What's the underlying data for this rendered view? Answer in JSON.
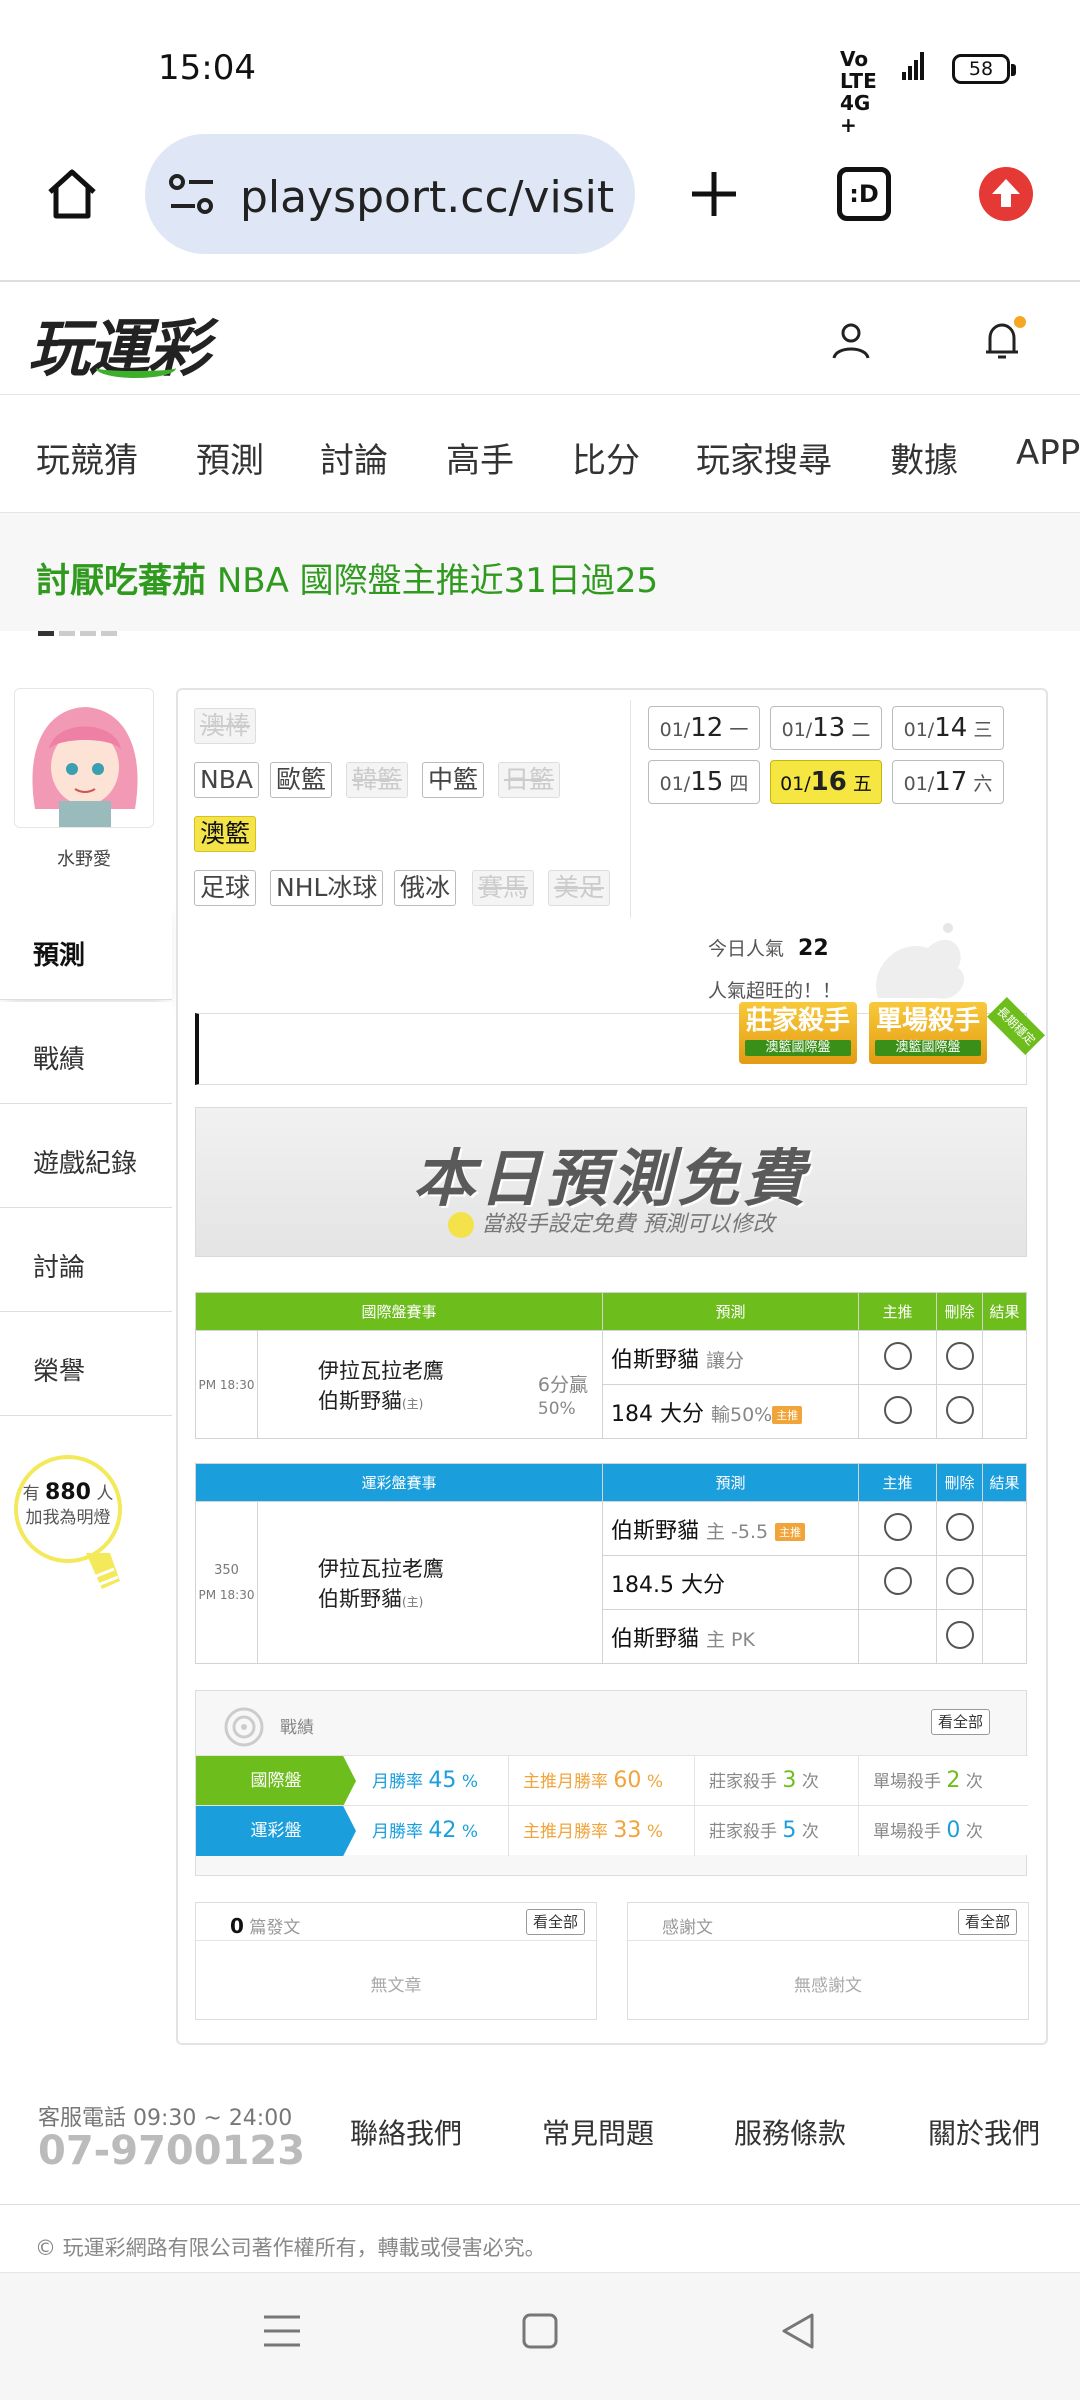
{
  "status_bar": {
    "time": "15:04",
    "network": "Vo LTE 4G+",
    "battery": "58"
  },
  "browser": {
    "url": "playsport.cc/visit",
    "tab_icon": ":D"
  },
  "site": {
    "logo": "玩運彩"
  },
  "main_nav": [
    "玩競猜",
    "預測",
    "討論",
    "高手",
    "比分",
    "玩家搜尋",
    "數據",
    "APP"
  ],
  "marquee": {
    "user": "討厭吃蕃茄",
    "text": "NBA 國際盤主推近31日過25"
  },
  "profile": {
    "name": "水野愛",
    "side_tabs": [
      "預測",
      "戰績",
      "遊戲紀錄",
      "討論",
      "榮譽"
    ],
    "fans_prefix": "有",
    "fans_count": "880",
    "fans_unit": "人",
    "fans_action": "加我為明燈"
  },
  "sports": {
    "row1": [
      "澳棒"
    ],
    "row2": [
      "NBA",
      "歐籃",
      "韓籃",
      "中籃",
      "日籃"
    ],
    "row3": [
      "澳籃"
    ],
    "row4": [
      "足球",
      "NHL冰球",
      "俄冰",
      "賽馬",
      "美足"
    ]
  },
  "dates": [
    {
      "md": "01/",
      "d": "12",
      "w": "一"
    },
    {
      "md": "01/",
      "d": "13",
      "w": "二"
    },
    {
      "md": "01/",
      "d": "14",
      "w": "三"
    },
    {
      "md": "01/",
      "d": "15",
      "w": "四"
    },
    {
      "md": "01/",
      "d": "16",
      "w": "五"
    },
    {
      "md": "01/",
      "d": "17",
      "w": "六"
    }
  ],
  "popularity": {
    "label": "今日人氣",
    "value": "22",
    "note": "人氣超旺的！！"
  },
  "badges": {
    "b1": "莊家殺手",
    "b1_sub": "澳籃國際盤",
    "b2": "單場殺手",
    "b2_sub": "澳籃國際盤",
    "ribbon": "長期穩定"
  },
  "free_banner": {
    "title": "本日預測免費",
    "subtitle": "當殺手設定免費 預測可以修改"
  },
  "intl_table": {
    "headers": [
      "國際盤賽事",
      "預測",
      "主推",
      "刪除",
      "結果"
    ],
    "time": "PM 18:30",
    "team1": "伊拉瓦拉老鷹",
    "team2": "伯斯野貓",
    "home_mark": "(主)",
    "spread": "6分贏",
    "spread_pct": "50%",
    "pred1": "伯斯野貓",
    "pred1_note": "讓分",
    "pred2": "184 大分",
    "pred2_note": "輸50%",
    "pred2_tag": "主推"
  },
  "lottery_table": {
    "headers": [
      "運彩盤賽事",
      "預測",
      "主推",
      "刪除",
      "結果"
    ],
    "game_no": "350",
    "time": "PM 18:30",
    "team1": "伊拉瓦拉老鷹",
    "team2": "伯斯野貓",
    "home_mark": "(主)",
    "pred1": "伯斯野貓",
    "pred1_note": "主 -5.5",
    "pred1_tag": "主推",
    "pred2": "184.5 大分",
    "pred3": "伯斯野貓",
    "pred3_note": "主 PK"
  },
  "record": {
    "title": "戰績",
    "see_all": "看全部",
    "rows": [
      {
        "label": "國際盤",
        "win_label": "月勝率",
        "win": "45",
        "main_label": "主推月勝率",
        "main": "60",
        "pct": "%",
        "k1_label": "莊家殺手",
        "k1": "3",
        "k2_label": "單場殺手",
        "k2": "2",
        "unit": "次"
      },
      {
        "label": "運彩盤",
        "win_label": "月勝率",
        "win": "42",
        "main_label": "主推月勝率",
        "main": "33",
        "pct": "%",
        "k1_label": "莊家殺手",
        "k1": "5",
        "k2_label": "單場殺手",
        "k2": "0",
        "unit": "次"
      }
    ]
  },
  "posts": {
    "count": "0",
    "label": "篇發文",
    "see_all": "看全部",
    "empty": "無文章"
  },
  "thanks": {
    "label": "感謝文",
    "see_all": "看全部",
    "empty": "無感謝文"
  },
  "footer": {
    "hours": "客服電話 09:30 ~ 24:00",
    "phone": "07-9700123",
    "links": [
      "聯絡我們",
      "常見問題",
      "服務條款",
      "關於我們"
    ],
    "copyright": "© 玩運彩網路有限公司著作權所有，轉載或侵害必究。"
  },
  "colors": {
    "green": "#6dbe1d",
    "blue": "#1b9fdc",
    "yellow": "#f5e642",
    "orange": "#f0a43a",
    "red": "#e53935"
  }
}
